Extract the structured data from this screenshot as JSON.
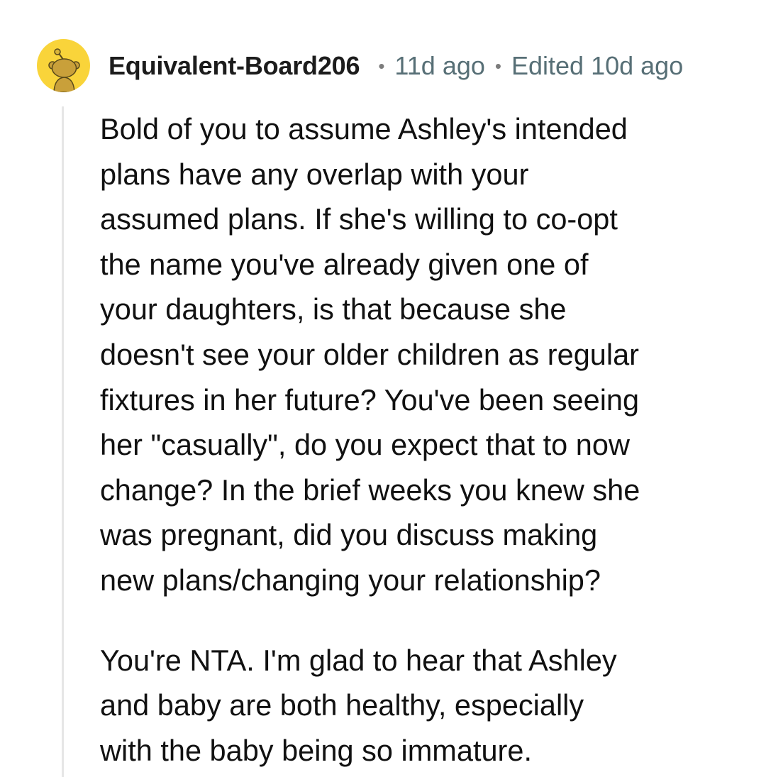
{
  "comment": {
    "author": "Equivalent-Board206",
    "separator": "•",
    "time_ago": "11d ago",
    "edited": "Edited 10d ago",
    "avatar_icon": "snoo-avatar-icon",
    "avatar_color": "#f9d43a",
    "paragraphs": [
      "Bold of you to assume Ashley's intended\nplans have any overlap with your\nassumed plans. If she's willing to co-opt\nthe name you've already given one of\nyour daughters, is that because she\ndoesn't see your older children as regular\nfixtures in her future? You've been seeing\nher \"casually\", do you expect that to now\nchange? In the brief weeks you knew she\nwas pregnant, did you discuss making\nnew plans/changing your relationship?",
      "You're NTA. I'm glad to hear that Ashley\nand baby are both healthy, especially\nwith the baby being so immature."
    ]
  }
}
